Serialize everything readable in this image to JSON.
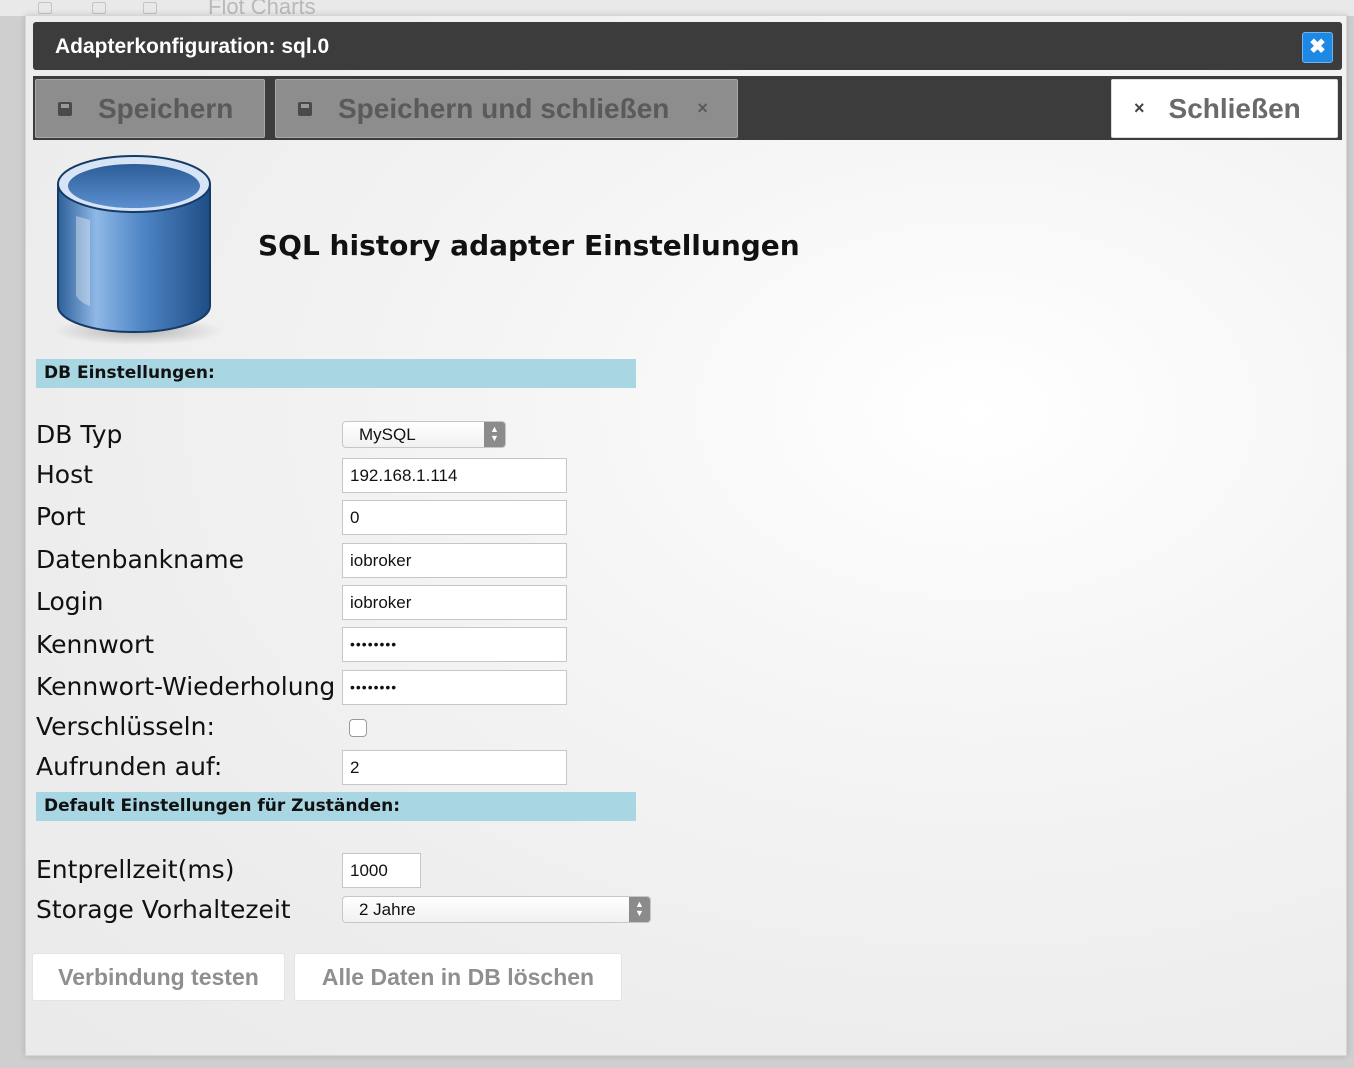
{
  "background": {
    "title": "Flot Charts"
  },
  "dialog": {
    "title": "Adapterkonfiguration: sql.0",
    "close_icon": "close-icon",
    "accent_color": "#1e88e5"
  },
  "toolbar": {
    "save_label": "Speichern",
    "save_close_label": "Speichern und schließen",
    "close_label": "Schließen",
    "x_glyph": "×"
  },
  "main": {
    "heading": "SQL history adapter Einstellungen",
    "section_db": "DB Einstellungen:",
    "section_defaults": "Default Einstellungen für Zuständen:",
    "section_color": "#a8d6e3"
  },
  "form": {
    "db_type_label": "DB Typ",
    "db_type_value": "MySQL",
    "host_label": "Host",
    "host_value": "192.168.1.114",
    "port_label": "Port",
    "port_value": "0",
    "dbname_label": "Datenbankname",
    "dbname_value": "iobroker",
    "login_label": "Login",
    "login_value": "iobroker",
    "password_label": "Kennwort",
    "password_value": "••••••••",
    "password_repeat_label": "Kennwort-Wiederholung",
    "password_repeat_value": "••••••••",
    "encrypt_label": "Verschlüsseln:",
    "encrypt_checked": false,
    "round_label": "Aufrunden auf:",
    "round_value": "2",
    "debounce_label": "Entprellzeit(ms)",
    "debounce_value": "1000",
    "retention_label": "Storage Vorhaltezeit",
    "retention_value": "2 Jahre"
  },
  "actions": {
    "test_connection": "Verbindung testen",
    "delete_all": "Alle Daten in DB löschen"
  }
}
